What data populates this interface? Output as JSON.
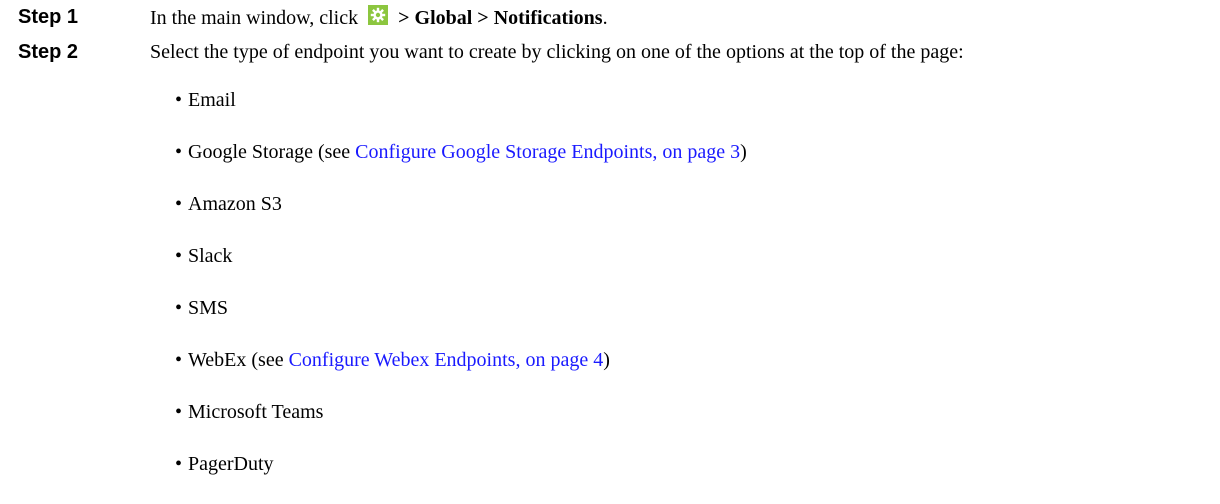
{
  "steps": [
    {
      "label": "Step 1",
      "text_before": "In the main window, click",
      "icon": "gear-icon",
      "icon_color": "#8cc63f",
      "path": "> Global > Notifications",
      "text_after": "."
    },
    {
      "label": "Step 2",
      "text": "Select the type of endpoint you want to create by clicking on one of the options at the top of the page:"
    }
  ],
  "bullet_glyph": "•",
  "endpoints": [
    {
      "name": "Email"
    },
    {
      "name": "Google Storage (see ",
      "link": "Configure Google Storage Endpoints, on page 3",
      "after": ")"
    },
    {
      "name": "Amazon S3"
    },
    {
      "name": "Slack"
    },
    {
      "name": "SMS"
    },
    {
      "name": "WebEx (see ",
      "link": "Configure Webex Endpoints, on page 4",
      "after": ")"
    },
    {
      "name": "Microsoft Teams"
    },
    {
      "name": "PagerDuty"
    }
  ],
  "colors": {
    "text": "#000000",
    "link": "#1a1aff",
    "icon_bg": "#8cc63f"
  }
}
